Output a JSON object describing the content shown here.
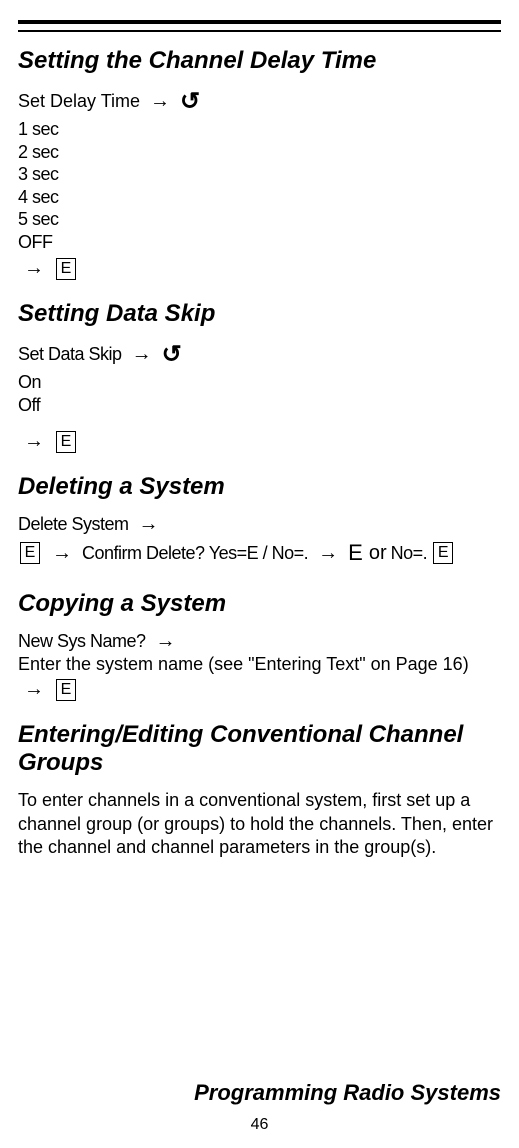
{
  "headings": {
    "channel_delay": "Setting the Channel Delay Time",
    "data_skip": "Setting Data Skip",
    "deleting": "Deleting a System",
    "copying": "Copying a System",
    "entering": "Entering/Editing Conventional Channel Groups"
  },
  "channel_delay": {
    "label": "Set Delay Time",
    "options": {
      "o1": "1 sec",
      "o2": "2 sec",
      "o3": "3 sec",
      "o4": "4 sec",
      "o5": "5 sec",
      "o6": "OFF"
    }
  },
  "data_skip": {
    "label": "Set Data Skip",
    "options": {
      "o1": "On",
      "o2": "Off"
    }
  },
  "deleting": {
    "label": "Delete System",
    "confirm": "Confirm Delete? Yes=E / No=.",
    "e": "E",
    "or": "or",
    "no": "No=."
  },
  "copying": {
    "label": "New Sys Name?",
    "instruction": "Enter the system name (see \"Entering Text\" on Page 16)"
  },
  "entering": {
    "body": "To enter channels in a conventional system, first set up a channel group (or groups) to hold the channels. Then, enter the channel and channel parameters in the group(s)."
  },
  "symbols": {
    "arrow": "→",
    "rotate": "↺",
    "e_box": "E"
  },
  "footer": {
    "title": "Programming Radio Systems",
    "page": "46"
  }
}
